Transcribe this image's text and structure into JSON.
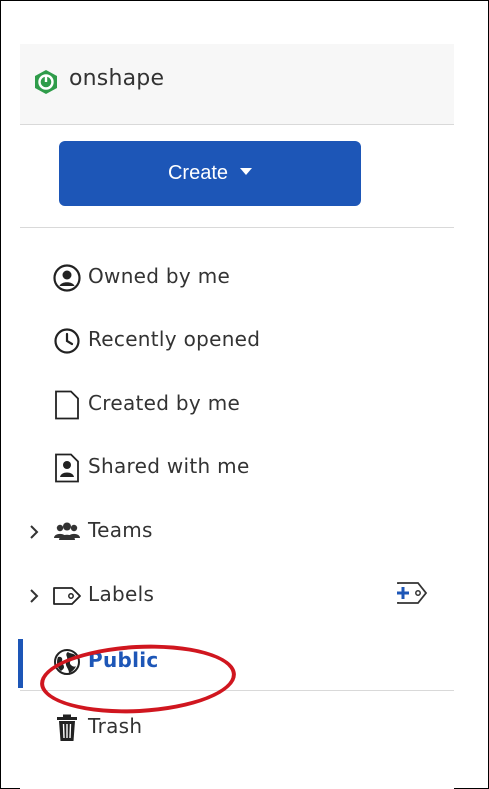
{
  "brand": {
    "name": "onshape",
    "logo_icon": "onshape-logo-icon",
    "logo_color": "#2f9c4a"
  },
  "create_button": {
    "label": "Create",
    "color": "#1d56b7"
  },
  "nav": {
    "items": [
      {
        "label": "Owned by me",
        "icon": "user-circle-icon"
      },
      {
        "label": "Recently opened",
        "icon": "clock-icon"
      },
      {
        "label": "Created by me",
        "icon": "document-icon"
      },
      {
        "label": "Shared with me",
        "icon": "shared-user-icon"
      },
      {
        "label": "Teams",
        "icon": "team-icon",
        "expandable": true
      },
      {
        "label": "Labels",
        "icon": "tag-icon",
        "expandable": true,
        "action_icon": "add-label-icon"
      },
      {
        "label": "Public",
        "icon": "globe-icon",
        "active": true
      },
      {
        "label": "Trash",
        "icon": "trash-icon"
      }
    ]
  },
  "colors": {
    "active_text": "#1d56b7",
    "active_bar": "#1d56b7",
    "annotation": "#d0161f",
    "text": "#333333"
  }
}
